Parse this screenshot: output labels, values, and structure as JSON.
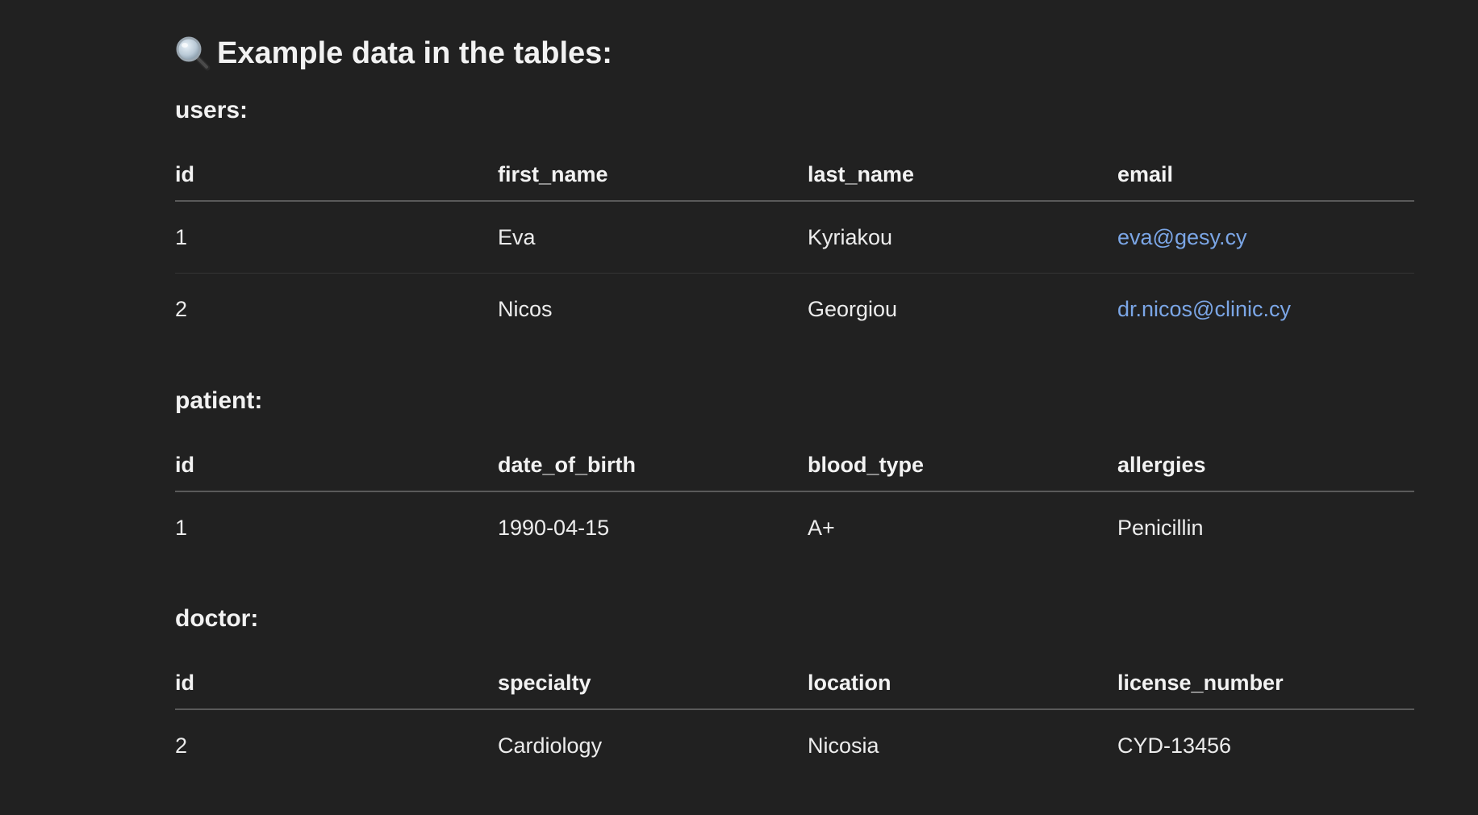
{
  "heading": {
    "icon": "magnifying-glass-icon",
    "text": "Example data in the tables:"
  },
  "colors": {
    "background": "#212121",
    "text": "#ececec",
    "link": "#7ba6e6"
  },
  "tables": {
    "users": {
      "title": "users:",
      "headers": [
        "id",
        "first_name",
        "last_name",
        "email"
      ],
      "rows": [
        [
          "1",
          "Eva",
          "Kyriakou",
          "eva@gesy.cy"
        ],
        [
          "2",
          "Nicos",
          "Georgiou",
          "dr.nicos@clinic.cy"
        ]
      ]
    },
    "patient": {
      "title": "patient:",
      "headers": [
        "id",
        "date_of_birth",
        "blood_type",
        "allergies"
      ],
      "rows": [
        [
          "1",
          "1990-04-15",
          "A+",
          "Penicillin"
        ]
      ]
    },
    "doctor": {
      "title": "doctor:",
      "headers": [
        "id",
        "specialty",
        "location",
        "license_number"
      ],
      "rows": [
        [
          "2",
          "Cardiology",
          "Nicosia",
          "CYD-13456"
        ]
      ]
    }
  }
}
